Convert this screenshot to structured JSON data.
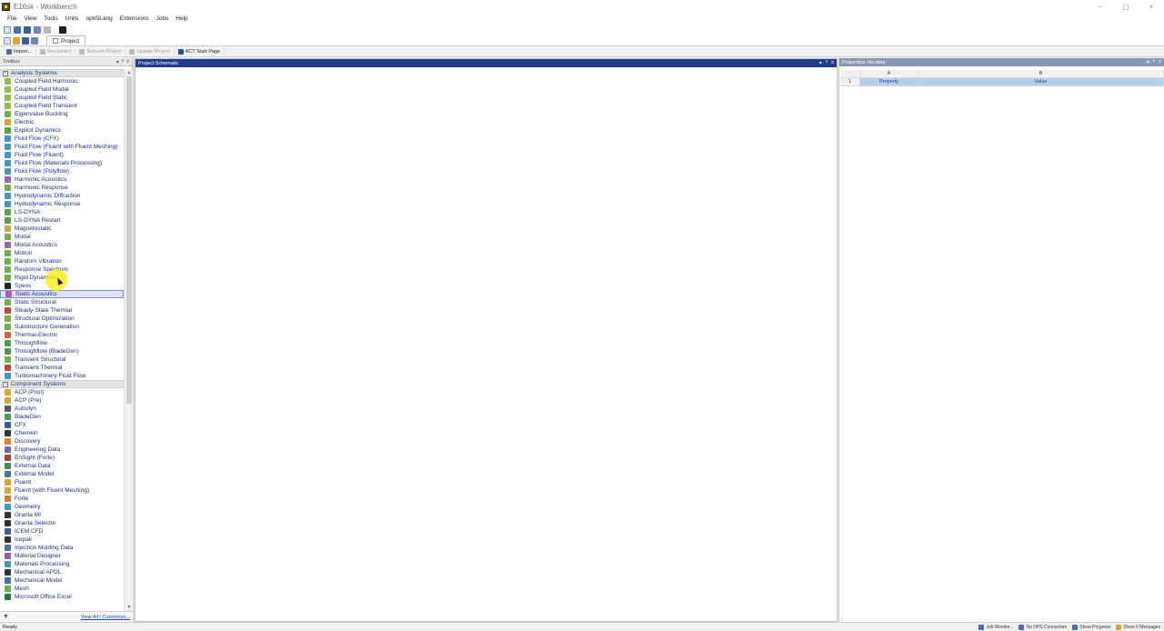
{
  "window": {
    "title": "E16sk - Workbench",
    "min": "–",
    "max": "▢",
    "close": "×"
  },
  "menu": [
    "File",
    "View",
    "Tools",
    "Units",
    "optiSLang",
    "Extensions",
    "Jobs",
    "Help"
  ],
  "tabs": {
    "project_label": "Project"
  },
  "toolbar": {
    "import_label": "Import...",
    "reconnect_label": "Reconnect",
    "refresh_label": "Refresh Project",
    "update_label": "Update Project",
    "act_label": "ACT Start Page"
  },
  "toolbox": {
    "title": "Toolbox",
    "pin": "ᵖ",
    "close": "x",
    "analysis_title": "Analysis Systems",
    "analysis_items": [
      {
        "label": "Coupled Field Harmonic",
        "color": "#8fbf3e"
      },
      {
        "label": "Coupled Field Modal",
        "color": "#8fbf3e"
      },
      {
        "label": "Coupled Field Static",
        "color": "#8fbf3e"
      },
      {
        "label": "Coupled Field Transient",
        "color": "#8fbf3e"
      },
      {
        "label": "Eigenvalue Buckling",
        "color": "#6fb33f"
      },
      {
        "label": "Electric",
        "color": "#e0a030"
      },
      {
        "label": "Explicit Dynamics",
        "color": "#5aa63a"
      },
      {
        "label": "Fluid Flow (CFX)",
        "color": "#3c9bc4"
      },
      {
        "label": "Fluid Flow (Fluent with Fluent Meshing)",
        "color": "#3c9bc4"
      },
      {
        "label": "Fluid Flow (Fluent)",
        "color": "#3c9bc4"
      },
      {
        "label": "Fluid Flow (Materials Processing)",
        "color": "#3c9bc4"
      },
      {
        "label": "Fluid Flow (Polyflow)",
        "color": "#3c9bc4"
      },
      {
        "label": "Harmonic Acoustics",
        "color": "#a65fb3"
      },
      {
        "label": "Harmonic Response",
        "color": "#6fb33f"
      },
      {
        "label": "Hydrodynamic Diffraction",
        "color": "#3c9bc4"
      },
      {
        "label": "Hydrodynamic Response",
        "color": "#3c9bc4"
      },
      {
        "label": "LS-DYNA",
        "color": "#5aa63a"
      },
      {
        "label": "LS-DYNA Restart",
        "color": "#5aa63a"
      },
      {
        "label": "Magnetostatic",
        "color": "#e0a030"
      },
      {
        "label": "Modal",
        "color": "#6fb33f"
      },
      {
        "label": "Modal Acoustics",
        "color": "#a65fb3"
      },
      {
        "label": "Motion",
        "color": "#6fb33f"
      },
      {
        "label": "Random Vibration",
        "color": "#6fb33f"
      },
      {
        "label": "Response Spectrum",
        "color": "#6fb33f"
      },
      {
        "label": "Rigid Dynamics",
        "color": "#6fb33f"
      },
      {
        "label": "Speos",
        "color": "#222222"
      },
      {
        "label": "Static Acoustics",
        "color": "#a65fb3"
      },
      {
        "label": "Static Structural",
        "color": "#6fb33f"
      },
      {
        "label": "Steady-State Thermal",
        "color": "#c8452f"
      },
      {
        "label": "Structural Optimization",
        "color": "#6fb33f"
      },
      {
        "label": "Substructure Generation",
        "color": "#6fb33f"
      },
      {
        "label": "Thermal-Electric",
        "color": "#d46a2f"
      },
      {
        "label": "Throughflow",
        "color": "#4aa04a"
      },
      {
        "label": "Throughflow (BladeGen)",
        "color": "#4aa04a"
      },
      {
        "label": "Transient Structural",
        "color": "#6fb33f"
      },
      {
        "label": "Transient Thermal",
        "color": "#c8452f"
      },
      {
        "label": "Turbomachinery Fluid Flow",
        "color": "#3c9bc4"
      }
    ],
    "selected_index": 26,
    "component_title": "Component Systems",
    "component_items": [
      {
        "label": "ACP (Post)",
        "color": "#d9a62b"
      },
      {
        "label": "ACP (Pre)",
        "color": "#d9a62b"
      },
      {
        "label": "Autodyn",
        "color": "#5a5a5a"
      },
      {
        "label": "BladeGen",
        "color": "#4aa04a"
      },
      {
        "label": "CFX",
        "color": "#3c5d9c"
      },
      {
        "label": "Chemkin",
        "color": "#333333"
      },
      {
        "label": "Discovery",
        "color": "#e08a1e"
      },
      {
        "label": "Engineering Data",
        "color": "#6b6bb8"
      },
      {
        "label": "EnSight (Forte)",
        "color": "#b33c3c"
      },
      {
        "label": "External Data",
        "color": "#4a8a4a"
      },
      {
        "label": "External Model",
        "color": "#4a6fb3"
      },
      {
        "label": "Fluent",
        "color": "#d9a62b"
      },
      {
        "label": "Fluent (with Fluent Meshing)",
        "color": "#d9a62b"
      },
      {
        "label": "Forte",
        "color": "#d97a1e"
      },
      {
        "label": "Geometry",
        "color": "#3c9bc4"
      },
      {
        "label": "Granta MI",
        "color": "#333333"
      },
      {
        "label": "Granta Selector",
        "color": "#333333"
      },
      {
        "label": "ICEM CFD",
        "color": "#3c5d9c"
      },
      {
        "label": "Icepak",
        "color": "#333333"
      },
      {
        "label": "Injection Molding Data",
        "color": "#4a6fb3"
      },
      {
        "label": "Material Designer",
        "color": "#9b59b6"
      },
      {
        "label": "Materials Processing",
        "color": "#3c9bc4"
      },
      {
        "label": "Mechanical APDL",
        "color": "#333333"
      },
      {
        "label": "Mechanical Model",
        "color": "#4a6fb3"
      },
      {
        "label": "Mesh",
        "color": "#6fb33f"
      },
      {
        "label": "Microsoft Office Excel",
        "color": "#1e7a3a"
      }
    ],
    "view_all_label": "View All / Customize..."
  },
  "schematic": {
    "title": "Project Schematic",
    "dropdown": "▾",
    "pin": "ᵖ",
    "close": "x"
  },
  "properties": {
    "title": "Properties: No data",
    "col_a": "A",
    "col_b": "B",
    "row_num": "1",
    "prop_label": "Property",
    "value_label": "Value"
  },
  "status": {
    "text": "Ready",
    "job_monitor": "Job Monitor...",
    "dps": "No DPS Connection",
    "progress": "Show Progress",
    "messages": "Show 0 Messages"
  },
  "colors": {
    "accent": "#1f3d8f",
    "selected": "#dde3f7",
    "properties_header": "#8897b7"
  }
}
